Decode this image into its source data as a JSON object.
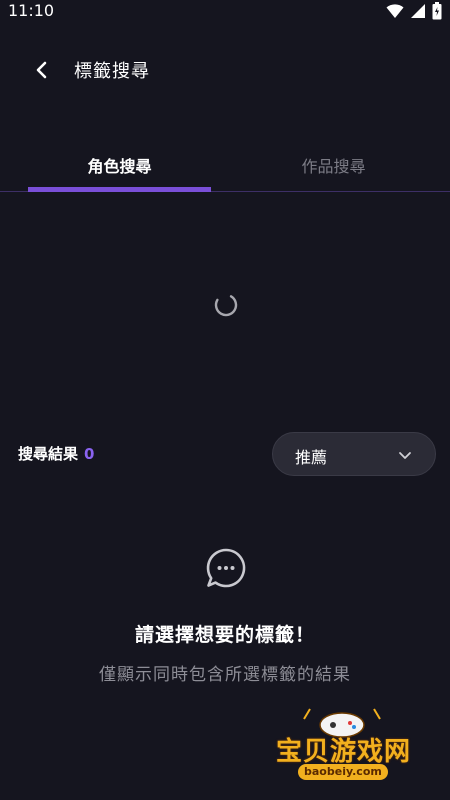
{
  "status_bar": {
    "time": "11:10",
    "icons": [
      "wifi-icon",
      "signal-icon",
      "battery-icon"
    ]
  },
  "header": {
    "title": "標籤搜尋",
    "back_icon": "chevron-left-icon"
  },
  "tabs": [
    {
      "label": "角色搜尋",
      "active": true
    },
    {
      "label": "作品搜尋",
      "active": false
    }
  ],
  "results": {
    "label": "搜尋結果",
    "count": "0"
  },
  "sort": {
    "selected": "推薦"
  },
  "empty_state": {
    "icon": "chat-bubble-icon",
    "title": "請選擇想要的標籤！",
    "subtitle": "僅顯示同時包含所選標籤的結果"
  },
  "watermark": {
    "text": "宝贝游戏网",
    "url": "baobeiy.com"
  },
  "colors": {
    "background": "#15151f",
    "accent": "#7a4fd8",
    "count": "#8a63f0",
    "inactive_tab": "#7c7c86",
    "select_bg": "#2b2b36"
  }
}
